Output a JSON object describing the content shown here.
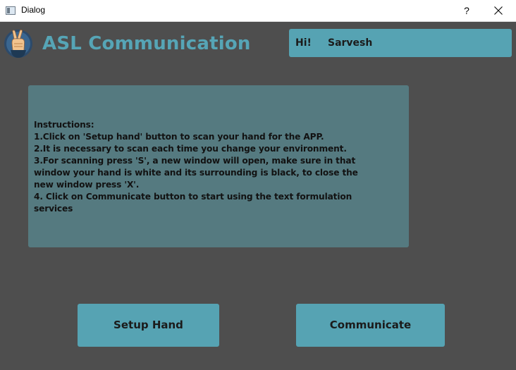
{
  "window": {
    "title": "Dialog",
    "help_label": "?",
    "close_icon": "close-icon"
  },
  "header": {
    "app_title": "ASL Communication",
    "logo_icon": "peace-hand-icon",
    "greeting": {
      "hi": "Hi!",
      "user": "Sarvesh"
    }
  },
  "instructions": {
    "lines": [
      "Instructions:",
      "1.Click on 'Setup hand' button to scan your hand for the APP.",
      "2.It is necessary to scan each time you change your environment.",
      "3.For scanning press 'S', a new window will open, make sure in that",
      "window your hand is white and its surrounding is black, to close the",
      "new window press 'X'.",
      "4. Click on Communicate button to start using the text formulation",
      "services"
    ]
  },
  "buttons": {
    "setup": "Setup Hand",
    "communicate": "Communicate"
  },
  "colors": {
    "background": "#4e4e4e",
    "accent": "#56a3b3",
    "title": "#56a5b6",
    "panel": "#557a80"
  }
}
